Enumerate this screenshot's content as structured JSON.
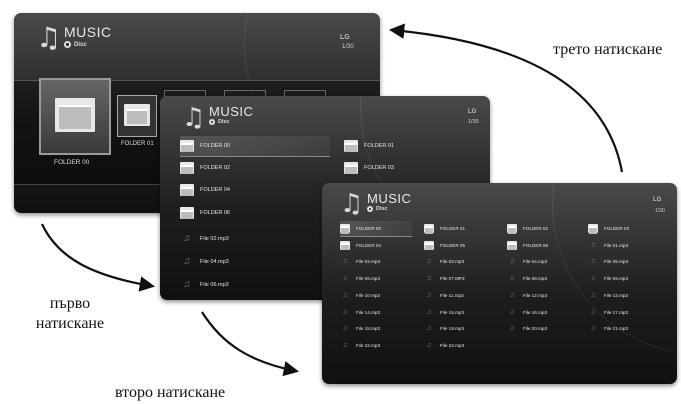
{
  "screens": {
    "s1": {
      "title": "MUSIC",
      "source": "Disc",
      "logo": "LG",
      "page": "1/30",
      "folders": [
        "FOLDER 00",
        "FOLDER 01"
      ]
    },
    "s2": {
      "title": "MUSIC",
      "source": "Disc",
      "logo": "LG",
      "page": "1/30",
      "items": [
        {
          "label": "FOLDER 00",
          "type": "folder"
        },
        {
          "label": "FOLDER 01",
          "type": "folder"
        },
        {
          "label": "FOLDER 02",
          "type": "folder"
        },
        {
          "label": "FOLDER 03",
          "type": "folder"
        },
        {
          "label": "FOLDER 04",
          "type": "folder"
        },
        {
          "label": "FOLDER 06",
          "type": "folder"
        },
        {
          "label": "File 02.mp3",
          "type": "file"
        },
        {
          "label": "File 04.mp3",
          "type": "file"
        },
        {
          "label": "File 06.mp3",
          "type": "file"
        }
      ]
    },
    "s3": {
      "title": "MUSIC",
      "source": "Disc",
      "logo": "LG",
      "page": "1/30",
      "items": [
        {
          "label": "FOLDER 00",
          "type": "folder"
        },
        {
          "label": "FOLDER 01",
          "type": "folder"
        },
        {
          "label": "FOLDER 02",
          "type": "folder"
        },
        {
          "label": "FOLDER 03",
          "type": "folder"
        },
        {
          "label": "FOLDER 04",
          "type": "folder"
        },
        {
          "label": "FOLDER 05",
          "type": "folder"
        },
        {
          "label": "FOLDER 06",
          "type": "folder"
        },
        {
          "label": "File 01.mp3",
          "type": "file"
        },
        {
          "label": "File 02.mp3",
          "type": "file"
        },
        {
          "label": "File 03.mp3",
          "type": "file"
        },
        {
          "label": "File 04.mp3",
          "type": "file"
        },
        {
          "label": "File 05.mp3",
          "type": "file"
        },
        {
          "label": "File 06.mp3",
          "type": "file"
        },
        {
          "label": "File 07.MP3",
          "type": "file"
        },
        {
          "label": "File 08.mp3",
          "type": "file"
        },
        {
          "label": "File 09.mp3",
          "type": "file"
        },
        {
          "label": "File 10.mp3",
          "type": "file"
        },
        {
          "label": "File 11.mp3",
          "type": "file"
        },
        {
          "label": "File 12.mp3",
          "type": "file"
        },
        {
          "label": "File 13.mp3",
          "type": "file"
        },
        {
          "label": "File 14.mp3",
          "type": "file"
        },
        {
          "label": "File 15.mp3",
          "type": "file"
        },
        {
          "label": "File 16.mp3",
          "type": "file"
        },
        {
          "label": "File 17.mp3",
          "type": "file"
        },
        {
          "label": "File 18.mp3",
          "type": "file"
        },
        {
          "label": "File 19.mp3",
          "type": "file"
        },
        {
          "label": "File 20.mp3",
          "type": "file"
        },
        {
          "label": "File 21.mp3",
          "type": "file"
        },
        {
          "label": "File 22.mp3",
          "type": "file"
        },
        {
          "label": "File 23.mp3",
          "type": "file"
        }
      ]
    }
  },
  "captions": {
    "first_press": "първо натискане",
    "second_press": "второ натискане",
    "third_press": "трето натискане"
  }
}
